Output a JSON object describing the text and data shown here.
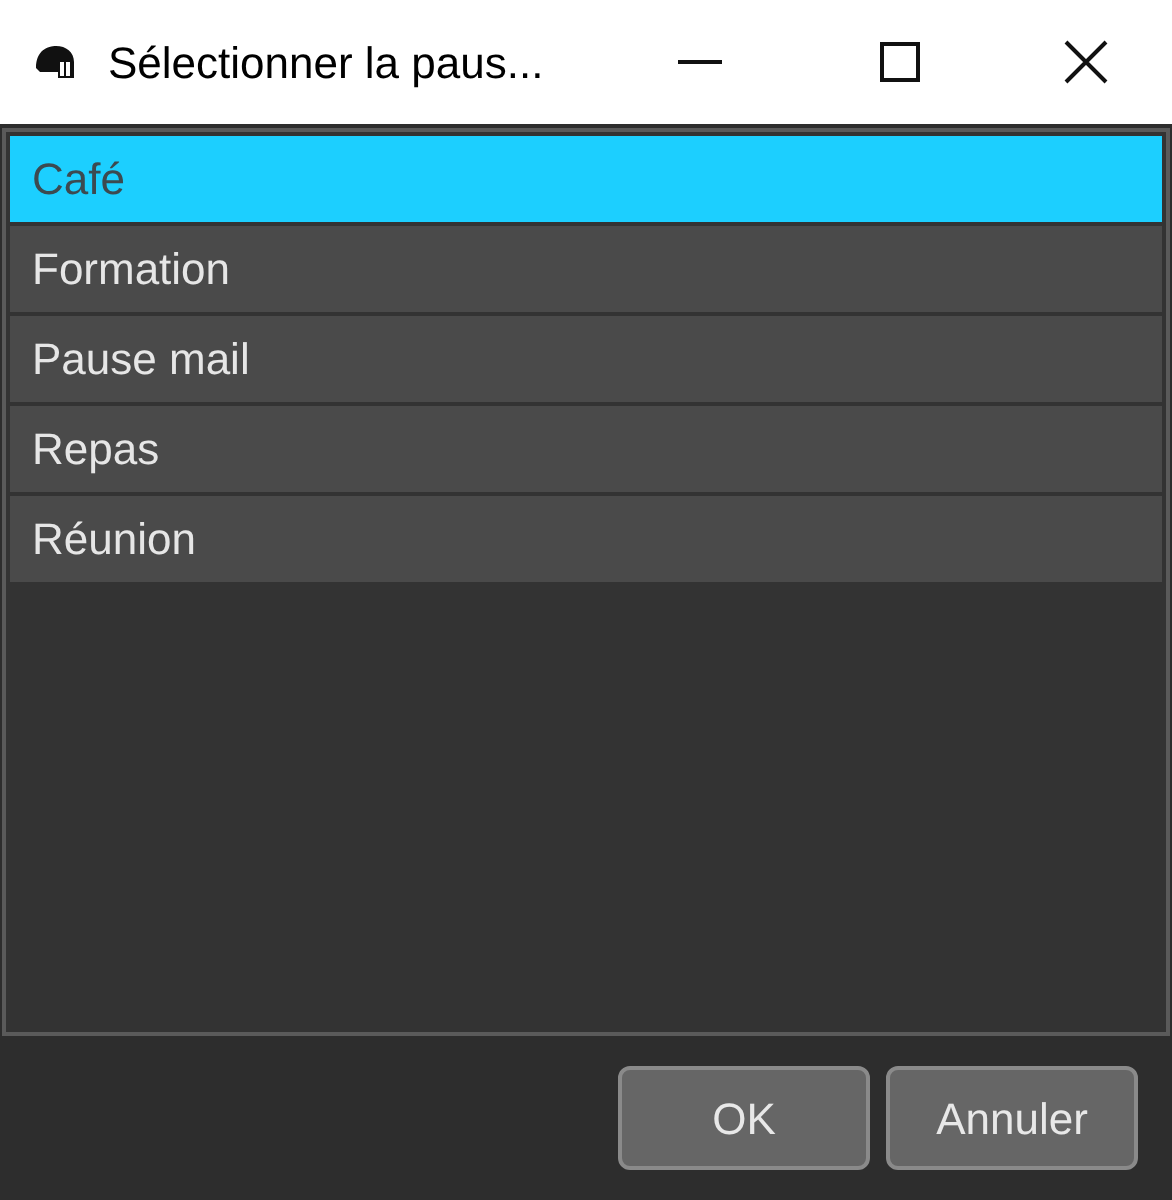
{
  "window": {
    "title": "Sélectionner la paus..."
  },
  "items": [
    {
      "label": "Café",
      "selected": true
    },
    {
      "label": "Formation",
      "selected": false
    },
    {
      "label": "Pause mail",
      "selected": false
    },
    {
      "label": "Repas",
      "selected": false
    },
    {
      "label": "Réunion",
      "selected": false
    }
  ],
  "buttons": [
    "OK",
    "Annuler"
  ]
}
